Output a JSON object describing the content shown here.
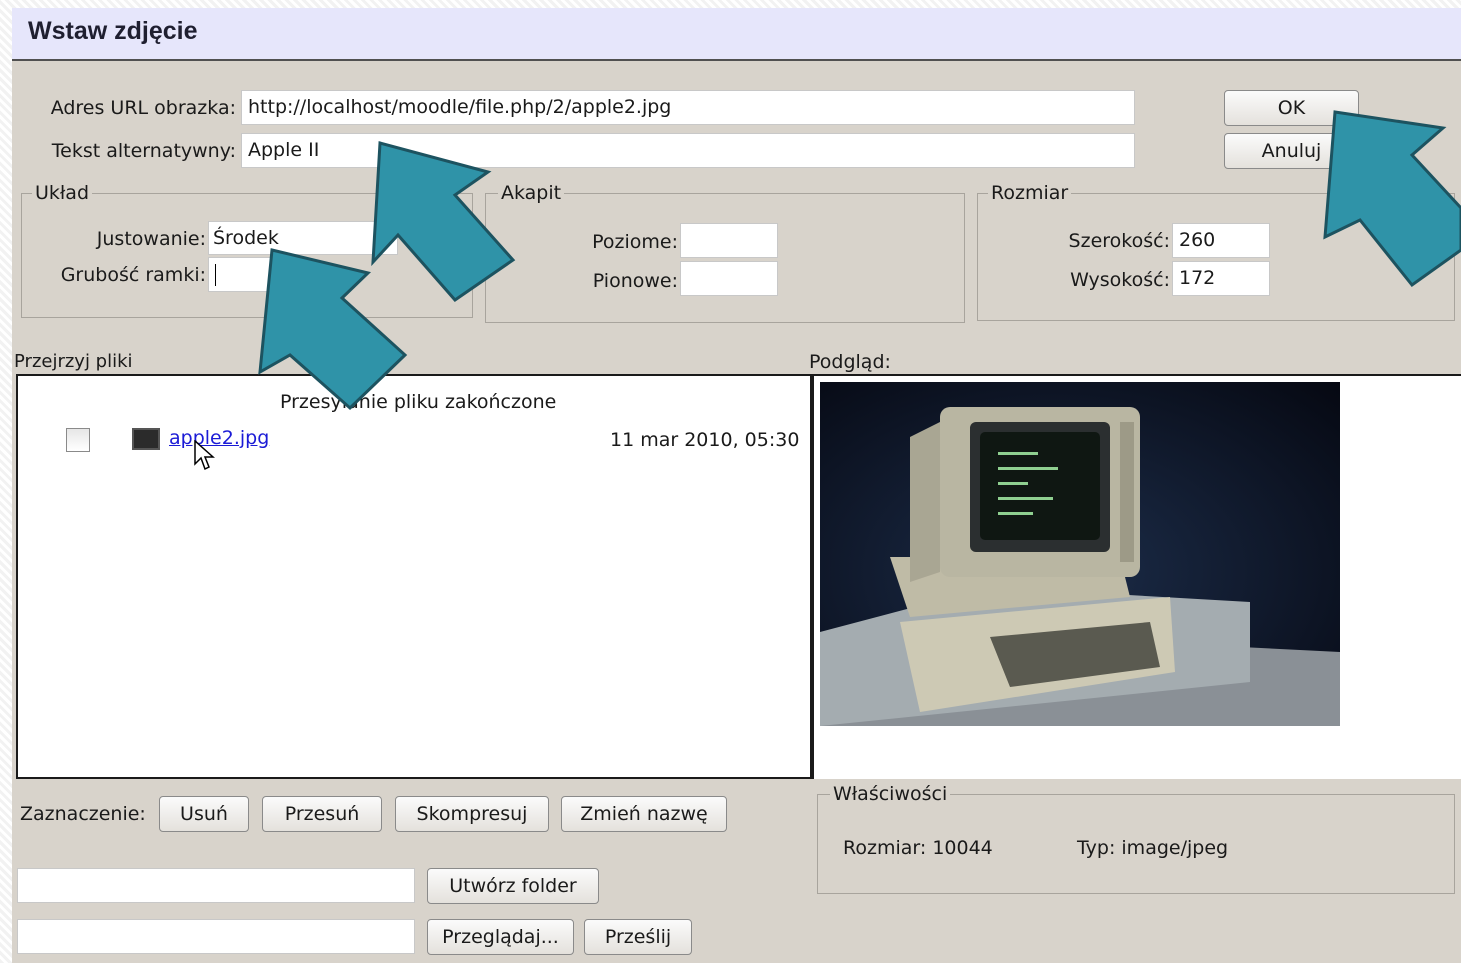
{
  "dialog": {
    "title": "Wstaw zdjęcie",
    "url_label": "Adres URL obrazka:",
    "url_value": "http://localhost/moodle/file.php/2/apple2.jpg",
    "alt_label": "Tekst alternatywny:",
    "alt_value": "Apple II",
    "ok_label": "OK",
    "cancel_label": "Anuluj"
  },
  "layout_group": {
    "legend": "Układ",
    "align_label": "Justowanie:",
    "align_value": "Środek",
    "border_label": "Grubość ramki:",
    "border_value": ""
  },
  "spacing_group": {
    "legend": "Akapit",
    "horizontal_label": "Poziome:",
    "horizontal_value": "",
    "vertical_label": "Pionowe:",
    "vertical_value": ""
  },
  "size_group": {
    "legend": "Rozmiar",
    "width_label": "Szerokość:",
    "width_value": "260",
    "height_label": "Wysokość:",
    "height_value": "172"
  },
  "browser": {
    "label": "Przejrzyj pliki",
    "status": "Przesyłanie pliku zakończone",
    "files": [
      {
        "name": "apple2.jpg",
        "date": "11 mar 2010, 05:30"
      }
    ]
  },
  "preview": {
    "label": "Podgląd:"
  },
  "selection": {
    "label": "Zaznaczenie:",
    "delete_label": "Usuń",
    "move_label": "Przesuń",
    "compress_label": "Skompresuj",
    "rename_label": "Zmień nazwę"
  },
  "folder": {
    "input_value": "",
    "create_label": "Utwórz folder"
  },
  "upload": {
    "input_value": "",
    "browse_label": "Przeglądaj...",
    "send_label": "Prześlij"
  },
  "properties": {
    "legend": "Właściwości",
    "size_label": "Rozmiar:",
    "size_value": "10044",
    "type_label": "Typ:",
    "type_value": "image/jpeg"
  },
  "colors": {
    "arrow": "#2f93a8",
    "arrow_outline": "#1d5360",
    "link": "#1b1bd6",
    "title_bg": "#e6e6fb"
  }
}
